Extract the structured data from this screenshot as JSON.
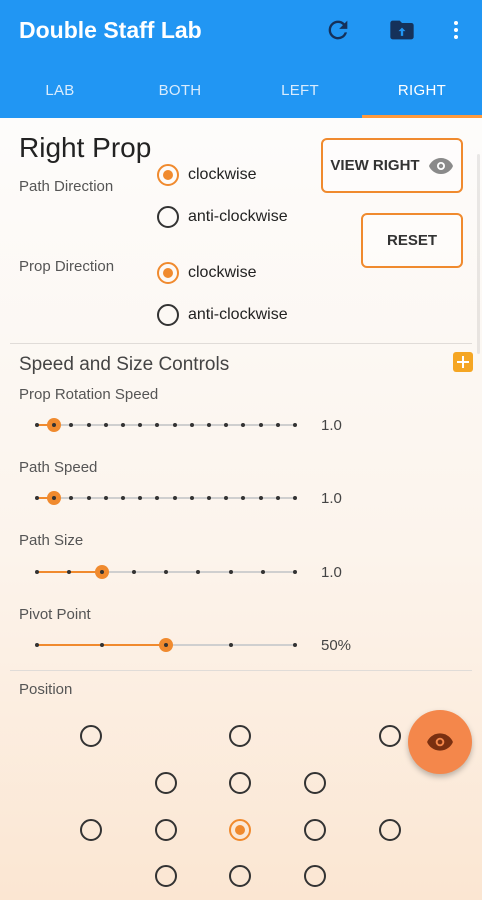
{
  "app": {
    "title": "Double Staff Lab"
  },
  "toolbar": {
    "refresh_icon": "refresh-icon",
    "export_icon": "folder-upload-icon",
    "menu_icon": "more-vert-icon"
  },
  "tabs": [
    {
      "label": "LAB",
      "active": false
    },
    {
      "label": "BOTH",
      "active": false
    },
    {
      "label": "LEFT",
      "active": false
    },
    {
      "label": "RIGHT",
      "active": true
    }
  ],
  "prop_section": {
    "title": "Right Prop",
    "path_direction": {
      "label": "Path Direction",
      "options": [
        "clockwise",
        "anti-clockwise"
      ],
      "selected": "clockwise"
    },
    "prop_direction": {
      "label": "Prop Direction",
      "options": [
        "clockwise",
        "anti-clockwise"
      ],
      "selected": "clockwise"
    },
    "view_button": "VIEW RIGHT",
    "reset_button": "RESET"
  },
  "speed_section": {
    "title": "Speed and Size Controls",
    "sliders": [
      {
        "label": "Prop Rotation Speed",
        "value_text": "1.0",
        "ticks": 16,
        "selected_index": 1
      },
      {
        "label": "Path Speed",
        "value_text": "1.0",
        "ticks": 16,
        "selected_index": 1
      },
      {
        "label": "Path Size",
        "value_text": "1.0",
        "ticks": 9,
        "selected_index": 2
      },
      {
        "label": "Pivot Point",
        "value_text": "50%",
        "ticks": 5,
        "selected_index": 2
      }
    ]
  },
  "position_section": {
    "label": "Position",
    "selected": "center"
  },
  "colors": {
    "primary": "#2196f3",
    "accent": "#f08a2e",
    "fab": "#f4874b"
  }
}
